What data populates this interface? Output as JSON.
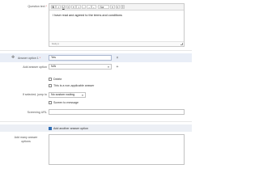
{
  "question_text": {
    "label": "Question text",
    "required_marker": "*",
    "toolbar": {
      "bold": "B",
      "italic": "I",
      "underline": "U",
      "style_select": "Nor",
      "buttons": [
        "B",
        "I",
        "U",
        "≡",
        "≡",
        "•",
        "…",
        "→",
        "←",
        "≡",
        "≡",
        "©"
      ]
    },
    "content": "I have read and agreed to the terms and conditions",
    "status": "body p"
  },
  "answer_option": {
    "label": "Answer option 1",
    "required_marker": "*",
    "value": "Yes"
  },
  "add_answer_option": {
    "label": "Add answer option",
    "value": "N/A"
  },
  "checkboxes": {
    "delete": "Delete",
    "non_applicable": "This is a non-applicable answer"
  },
  "jump": {
    "label": "If selected, jump to",
    "value": "No custom routing"
  },
  "screen_out": {
    "label": "Screen to message"
  },
  "screening_url": {
    "label": "Screening URL",
    "value": ""
  },
  "add_another": {
    "label": "Add another answer option"
  },
  "add_many": {
    "label_line1": "Add many answer",
    "label_line2": "options"
  }
}
